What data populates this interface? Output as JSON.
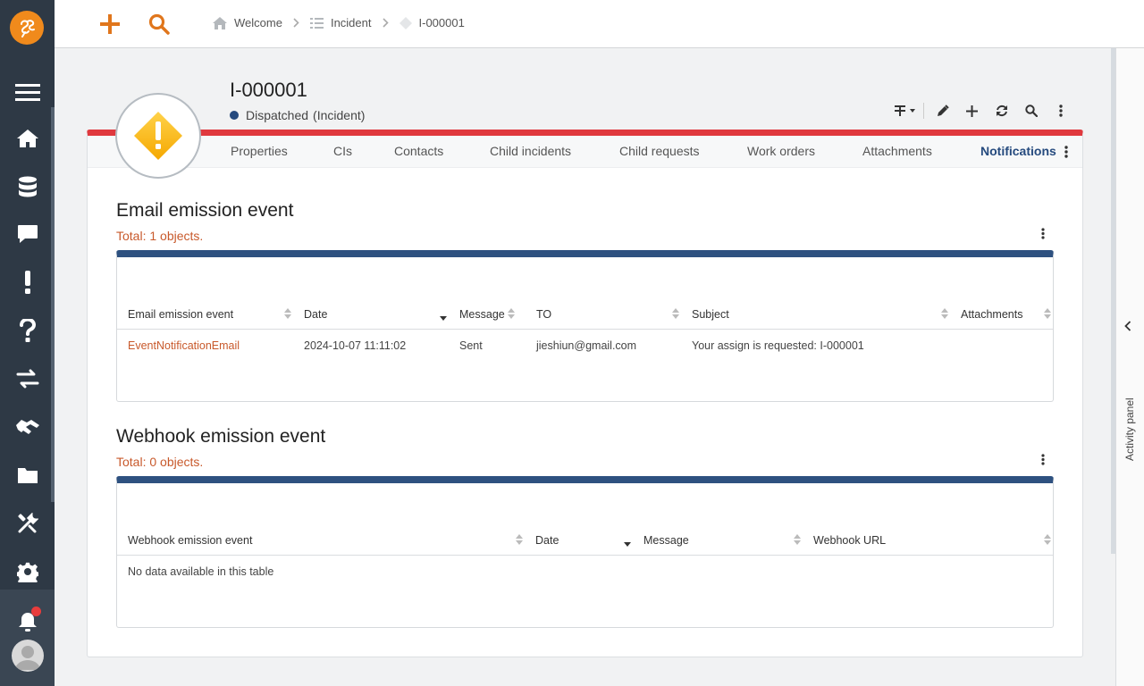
{
  "topbar": {
    "breadcrumb": [
      "Welcome",
      "Incident",
      "I-000001"
    ]
  },
  "record": {
    "title": "I-000001",
    "status": "Dispatched",
    "status_type": "(Incident)",
    "status_color": "#254a7e"
  },
  "tabs": [
    {
      "label": "Properties",
      "active": false
    },
    {
      "label": "CIs",
      "active": false
    },
    {
      "label": "Contacts",
      "active": false
    },
    {
      "label": "Child incidents",
      "active": false
    },
    {
      "label": "Child requests",
      "active": false
    },
    {
      "label": "Work orders",
      "active": false
    },
    {
      "label": "Attachments",
      "active": false
    },
    {
      "label": "Notifications",
      "active": true
    }
  ],
  "email_section": {
    "title": "Email emission event",
    "total": "Total: 1 objects.",
    "columns": [
      "Email emission event",
      "Date",
      "Message",
      "TO",
      "Subject",
      "Attachments"
    ],
    "rows": [
      {
        "event": "EventNotificationEmail",
        "date": "2024-10-07 11:11:02",
        "message": "Sent",
        "to": "jieshiun@gmail.com",
        "subject": "Your assign is requested: I-000001",
        "attachments": ""
      }
    ]
  },
  "webhook_section": {
    "title": "Webhook emission event",
    "total": "Total: 0 objects.",
    "columns": [
      "Webhook emission event",
      "Date",
      "Message",
      "Webhook URL"
    ],
    "empty_text": "No data available in this table"
  },
  "activity_panel": {
    "label": "Activity panel"
  },
  "colors": {
    "brand_orange": "#f08a1c",
    "nav_bg": "#2e3945",
    "accent_red": "#e0393e",
    "grid_header_blue": "#2e5180",
    "link_orange": "#c8592b",
    "notification_dot": "#e83c3c"
  },
  "icons": {
    "nav": [
      "menu-icon",
      "home-icon",
      "database-icon",
      "chat-icon",
      "exclamation-icon",
      "question-icon",
      "swap-icon",
      "handshake-icon",
      "folder-icon",
      "tools-icon",
      "gear-icon",
      "bell-icon",
      "avatar"
    ],
    "toolbar": [
      "layout-icon",
      "pencil-icon",
      "plus-icon",
      "refresh-icon",
      "search-icon",
      "kebab-icon"
    ]
  }
}
